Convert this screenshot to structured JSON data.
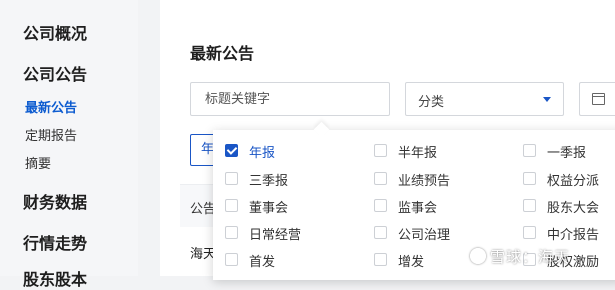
{
  "sidebar": {
    "sections": [
      {
        "label": "公司概况"
      },
      {
        "label": "公司公告"
      },
      {
        "label": "财务数据"
      },
      {
        "label": "行情走势"
      },
      {
        "label": "股东股本"
      }
    ],
    "sub_items": [
      {
        "label": "最新公告",
        "active": true
      },
      {
        "label": "定期报告",
        "active": false
      },
      {
        "label": "摘要",
        "active": false
      }
    ]
  },
  "main": {
    "title": "最新公告",
    "search": {
      "placeholder": "标题关键字",
      "value": ""
    },
    "category_select": {
      "value": "分类"
    },
    "year_chip": "年",
    "table": {
      "column_header": "公告",
      "first_row_text": "海天"
    }
  },
  "dropdown": {
    "options": [
      {
        "label": "年报",
        "checked": true
      },
      {
        "label": "半年报",
        "checked": false
      },
      {
        "label": "一季报",
        "checked": false
      },
      {
        "label": "三季报",
        "checked": false
      },
      {
        "label": "业绩预告",
        "checked": false
      },
      {
        "label": "权益分派",
        "checked": false
      },
      {
        "label": "董事会",
        "checked": false
      },
      {
        "label": "监事会",
        "checked": false
      },
      {
        "label": "股东大会",
        "checked": false
      },
      {
        "label": "日常经营",
        "checked": false
      },
      {
        "label": "公司治理",
        "checked": false
      },
      {
        "label": "中介报告",
        "checked": false
      },
      {
        "label": "首发",
        "checked": false
      },
      {
        "label": "增发",
        "checked": false
      },
      {
        "label": "股权激励",
        "checked": false
      }
    ]
  },
  "watermark": {
    "text": "雪球：海天"
  },
  "colors": {
    "accent": "#1a56c6",
    "sidebar_bg": "#f5f6f8",
    "page_bg": "#f2f3f5"
  }
}
